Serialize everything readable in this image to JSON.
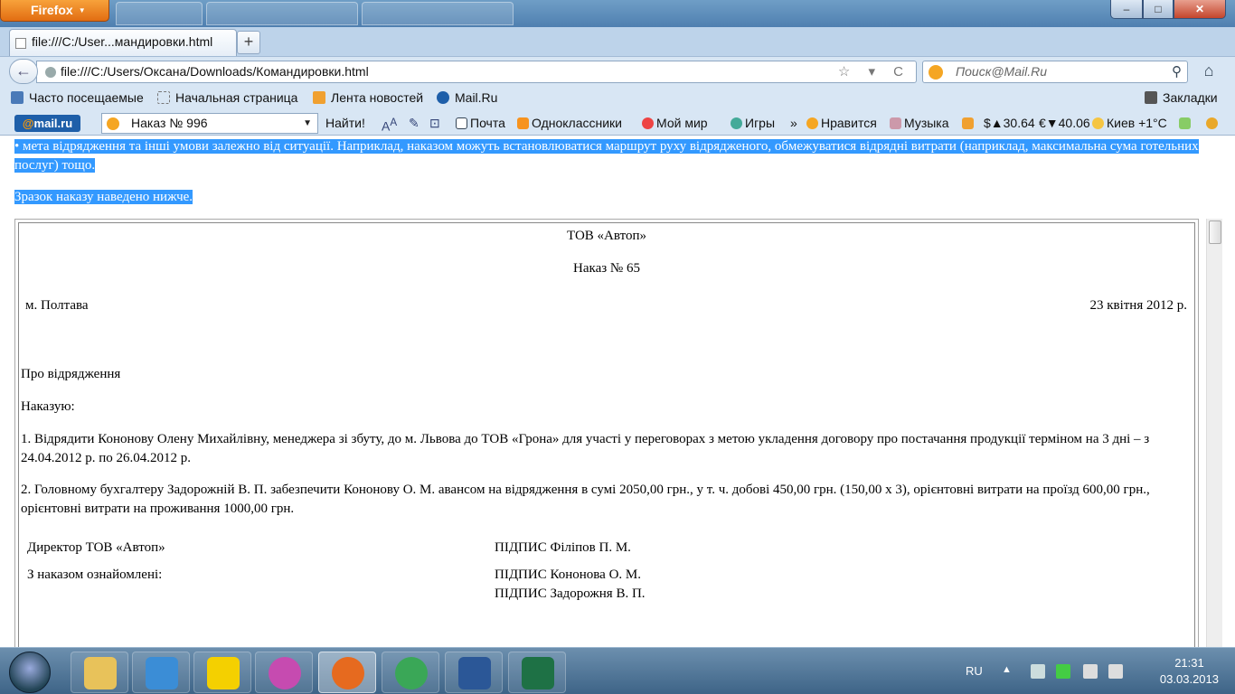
{
  "window": {
    "firefox_button": "Firefox",
    "minimize": "–",
    "maximize": "□",
    "close": "✕"
  },
  "tab": {
    "title": "file:///C:/User...мандировки.html",
    "new_tab": "+"
  },
  "nav": {
    "back": "←",
    "url": "file:///C:/Users/Оксана/Downloads/Командировки.html",
    "url_icons": "☆ ▾ C",
    "search_placeholder": "Поиск@Mail.Ru",
    "search_icon": "⚲",
    "home": "⌂"
  },
  "bookmarks": {
    "items": [
      "Часто посещаемые",
      "Начальная страница",
      "Лента новостей",
      "Mail.Ru"
    ],
    "right": "Закладки"
  },
  "mailbar": {
    "logo_at": "@",
    "logo_text": "mail.ru",
    "search_value": "Наказ № 996",
    "search_btn": "Найти!",
    "items": [
      "Почта",
      "Одноклассники",
      "Мой мир",
      "Игры",
      "»",
      "Нравится",
      "Музыка",
      "$▲30.64",
      "€▼40.06",
      "Киев +1°C"
    ]
  },
  "content": {
    "intro1": "• мета відрядження та інші умови залежно від ситуації. Наприклад, наказом можуть встановлюватися маршрут руху відрядженого, обмежуватися відрядні витрати (наприклад, максимальна сума готельних послуг) тощо.",
    "intro2": "Зразок наказу наведено нижче.",
    "doc": {
      "company": "ТОВ «Автоп»",
      "order_no": "Наказ № 65",
      "city": "м. Полтава",
      "date": "23 квітня 2012 р.",
      "subject": "Про відрядження",
      "order": "Наказую:",
      "p1": "1. Відрядити Кононову Олену Михайлівну, менеджера зі збуту, до м. Львова до ТОВ «Грона» для участі у переговорах з метою укладення договору про постачання продукції терміном на 3 дні – з 24.04.2012 р. по 26.04.2012 р.",
      "p2": "2. Головному бухгалтеру Задорожній В. П. забезпечити Кононову О. М. авансом на відрядження в сумі 2050,00 грн., у т. ч. добові 450,00 грн. (150,00 х 3), орієнтовні витрати на проїзд 600,00 грн., орієнтовні витрати на проживання 1000,00 грн.",
      "director_label": "Директор ТОВ «Автоп»",
      "director_sign": "ПІДПИС Філіпов П. М.",
      "acq_label": "З наказом ознайомлені:",
      "acq_sign1": "ПІДПИС Кононова О. М.",
      "acq_sign2": "ПІДПИС Задорожня В. П."
    }
  },
  "taskbar": {
    "lang": "RU",
    "time": "21:31",
    "date": "03.03.2013"
  }
}
